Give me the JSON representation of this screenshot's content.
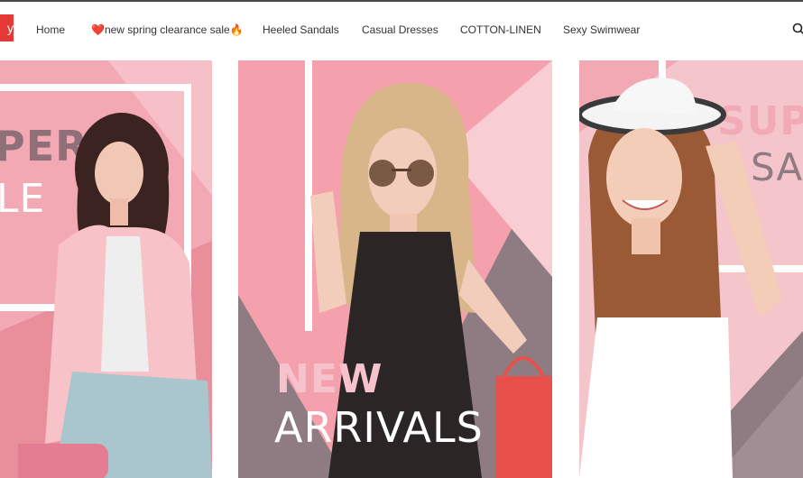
{
  "nav": {
    "logo_text": "y",
    "items": [
      {
        "label": "Home"
      },
      {
        "label": "❤️new spring clearance sale🔥"
      },
      {
        "label": "Heeled Sandals"
      },
      {
        "label": "Casual Dresses"
      },
      {
        "label": "COTTON-LINEN"
      },
      {
        "label": "Sexy Swimwear"
      }
    ],
    "search_icon": "search-icon"
  },
  "banners": [
    {
      "line1": "PER",
      "line2": "LE"
    },
    {
      "line1": "NEW",
      "line2": "ARRIVALS"
    },
    {
      "line1": "SUP",
      "line2": "SA"
    }
  ],
  "colors": {
    "accent": "#e53935",
    "banner_pink": "#f4a1ad",
    "banner_gray": "#8f7c82"
  }
}
